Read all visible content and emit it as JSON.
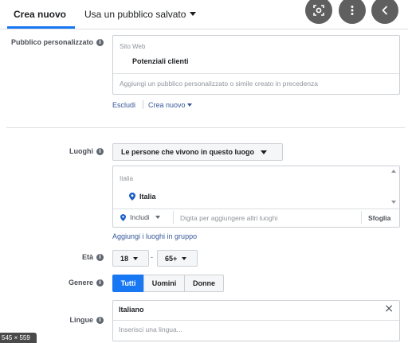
{
  "tabs": {
    "create_new": "Crea nuovo",
    "use_saved": "Usa un pubblico salvato"
  },
  "icons": {
    "lens": "lens-icon",
    "more": "more-vertical-icon",
    "back": "chevron-left-icon"
  },
  "custom_audience": {
    "label": "Pubblico personalizzato",
    "section": "Sito Web",
    "selected": "Potenziali clienti",
    "placeholder": "Aggiungi un pubblico personalizzato o simile creato in precedenza",
    "exclude": "Escludi",
    "create_new": "Crea nuovo"
  },
  "locations": {
    "label": "Luoghi",
    "dropdown": "Le persone che vivono in questo luogo",
    "section": "Italia",
    "selected": "Italia",
    "include": "Includi",
    "placeholder": "Digita per aggiungere altri luoghi",
    "browse": "Sfoglia",
    "add_group": "Aggiungi i luoghi in gruppo"
  },
  "age": {
    "label": "Età",
    "min": "18",
    "max": "65+",
    "dash": "-"
  },
  "gender": {
    "label": "Genere",
    "options": [
      "Tutti",
      "Uomini",
      "Donne"
    ],
    "selected": "Tutti"
  },
  "languages": {
    "label": "Lingue",
    "selected": "Italiano",
    "remove": "×",
    "placeholder": "Inserisci una lingua..."
  },
  "badge": "545 × 559",
  "colors": {
    "accent": "#1877f2",
    "link": "#365899",
    "button_dark": "#5f5f5f"
  }
}
